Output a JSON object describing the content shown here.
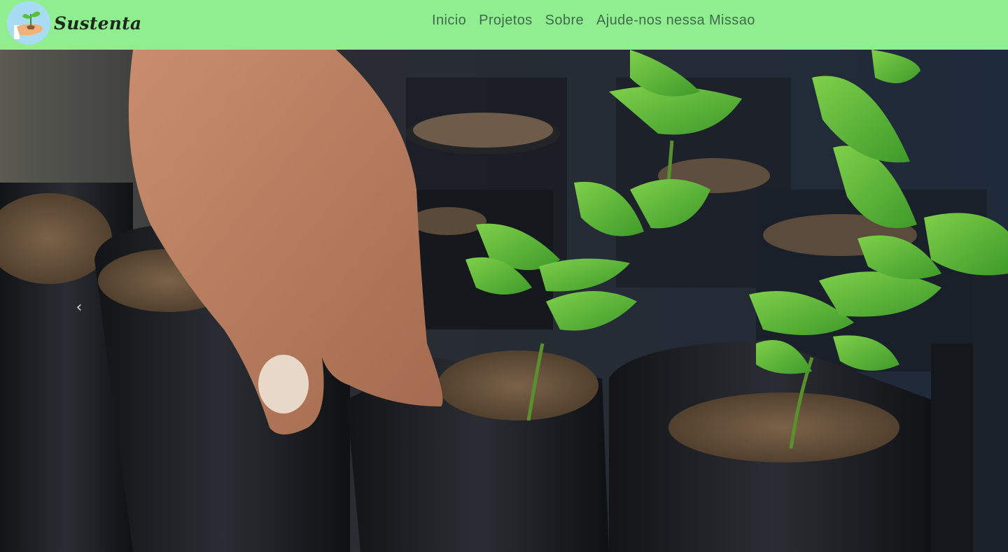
{
  "brand": {
    "name": "Sustenta",
    "logo_icon": "seedling-in-hand-icon"
  },
  "nav": {
    "items": [
      {
        "label": "Inicio"
      },
      {
        "label": "Projetos"
      },
      {
        "label": "Sobre"
      },
      {
        "label": "Ajude-nos nessa Missao"
      }
    ]
  },
  "carousel": {
    "prev_icon": "chevron-left-icon",
    "prev_glyph": "‹"
  },
  "colors": {
    "navbar_bg": "#90ee90",
    "nav_text": "#3f6b4a",
    "brand_text": "#1c2a1c"
  }
}
